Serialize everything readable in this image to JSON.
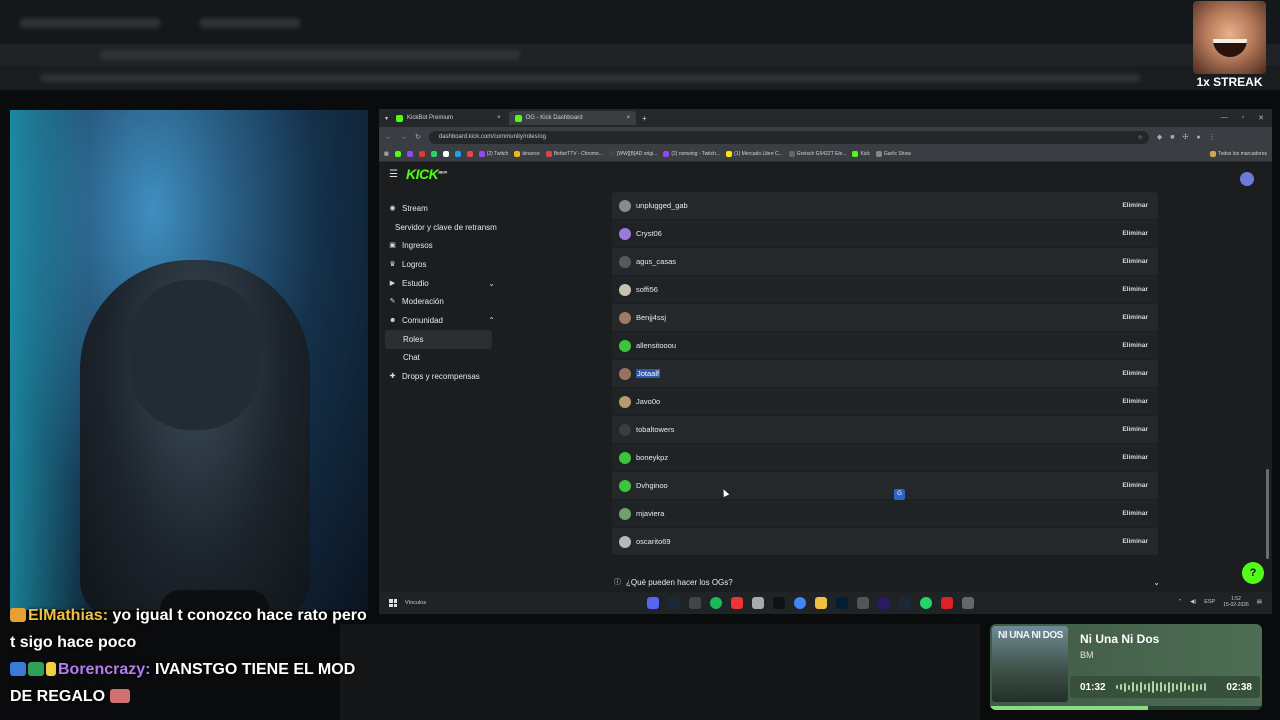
{
  "browser": {
    "tabs": [
      {
        "label": "KickBot Premium",
        "active": false
      },
      {
        "label": "OG - Kick Dashboard",
        "active": true
      }
    ],
    "new_tab_label": "+",
    "url": "dashboard.kick.com/community/roles/og",
    "bookmarks": [
      {
        "label": "(2) Twitch",
        "color": "#9147ff"
      },
      {
        "label": "binance",
        "color": "#f0b90b"
      },
      {
        "label": "BetterTTV - Chrome...",
        "color": "#d44"
      },
      {
        "label": "[WW][B]AD origi...",
        "color": "#444"
      },
      {
        "label": "(2) nonwing - Twitch...",
        "color": "#9147ff"
      },
      {
        "label": "(1) Mercado Libre C...",
        "color": "#ffe600"
      },
      {
        "label": "Gretsch G5422T Ele...",
        "color": "#666"
      },
      {
        "label": "Kick",
        "color": "#53fc18"
      },
      {
        "label": "Garlic Show",
        "color": "#888"
      }
    ],
    "all_bookmarks_label": "Todos los marcadores"
  },
  "kick": {
    "logo": "KICK",
    "logo_beta": "BETA",
    "nav": [
      {
        "label": "Stream",
        "icon": "broadcast-icon",
        "kind": "top"
      },
      {
        "label": "Servidor y clave de retransm",
        "icon": "",
        "kind": "sub"
      },
      {
        "label": "Ingresos",
        "icon": "money-icon",
        "kind": "top"
      },
      {
        "label": "Logros",
        "icon": "trophy-icon",
        "kind": "top"
      },
      {
        "label": "Estudio",
        "icon": "studio-icon",
        "kind": "top",
        "chevron": "down"
      },
      {
        "label": "Moderación",
        "icon": "wrench-icon",
        "kind": "top"
      },
      {
        "label": "Comunidad",
        "icon": "users-icon",
        "kind": "top",
        "chevron": "up"
      },
      {
        "label": "Roles",
        "icon": "",
        "kind": "selected"
      },
      {
        "label": "Chat",
        "icon": "",
        "kind": "child"
      },
      {
        "label": "Drops y recompensas",
        "icon": "gift-icon",
        "kind": "top"
      }
    ],
    "members": [
      {
        "name": "unplugged_gab",
        "avatar": "#8a8a8a"
      },
      {
        "name": "Cryst06",
        "avatar": "#9b7bd8"
      },
      {
        "name": "agus_casas",
        "avatar": "#555a5e"
      },
      {
        "name": "soffi56",
        "avatar": "#c8c2b0"
      },
      {
        "name": "Benjj4ssj",
        "avatar": "#a07868"
      },
      {
        "name": "allensitooou",
        "avatar": "#3ec43a"
      },
      {
        "name": "Jotaalf",
        "avatar": "#9a7060",
        "selected": true
      },
      {
        "name": "Javo0o",
        "avatar": "#b59a6a"
      },
      {
        "name": "tobaltowers",
        "avatar": "#3b3d40"
      },
      {
        "name": "boneykpz",
        "avatar": "#3ec43a"
      },
      {
        "name": "Dvhginoo",
        "avatar": "#3ec43a"
      },
      {
        "name": "mjaviera",
        "avatar": "#6fa06a"
      },
      {
        "name": "oscarito69",
        "avatar": "#b8b8b8"
      }
    ],
    "remove_label": "Eliminar",
    "faq": "¿Qué pueden hacer los OGs?"
  },
  "taskbar": {
    "search_label": "Vínculos",
    "lang": "ESP",
    "time": "1:52",
    "date": "15-02-2026"
  },
  "chat": [
    {
      "user": "ElMathias:",
      "user_color": "#f0c040",
      "text": "yo igual t conozco hace rato pero t sigo hace poco"
    },
    {
      "user": "Borencrazy:",
      "user_color": "#b47cf0",
      "text": "IVANSTGO TIENE EL MOD DE REGALO"
    }
  ],
  "streak": {
    "label": "1x STREAK"
  },
  "spotify": {
    "album_text": "NI UNA NI DOS",
    "title": "Ni Una Ni Dos",
    "artist": "BM",
    "current": "01:32",
    "total": "02:38",
    "progress": 0.58
  }
}
